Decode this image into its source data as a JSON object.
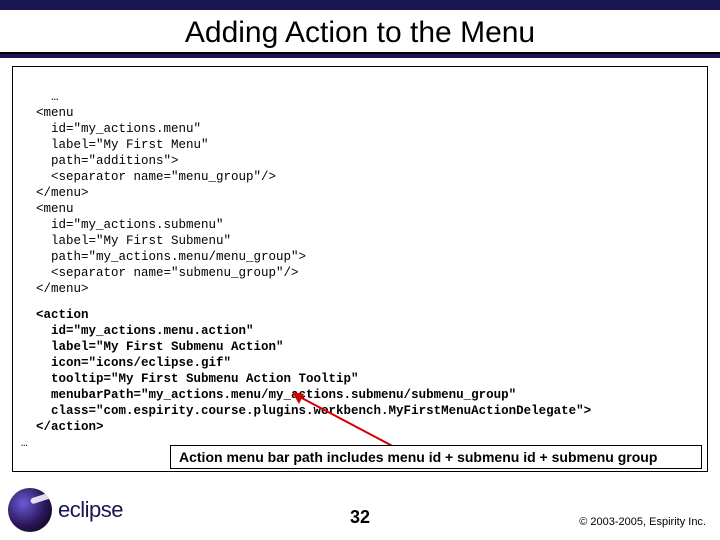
{
  "title": "Adding Action to the Menu",
  "code_block1": "…\n  <menu\n    id=\"my_actions.menu\"\n    label=\"My First Menu\"\n    path=\"additions\">\n    <separator name=\"menu_group\"/>\n  </menu>\n  <menu\n    id=\"my_actions.submenu\"\n    label=\"My First Submenu\"\n    path=\"my_actions.menu/menu_group\">\n    <separator name=\"submenu_group\"/>\n  </menu>",
  "code_block2": "  <action\n    id=\"my_actions.menu.action\"\n    label=\"My First Submenu Action\"\n    icon=\"icons/eclipse.gif\"\n    tooltip=\"My First Submenu Action Tooltip\"\n    menubarPath=\"my_actions.menu/my_actions.submenu/submenu_group\"\n    class=\"com.espirity.course.plugins.workbench.MyFirstMenuActionDelegate\">\n  </action>",
  "code_end": "…",
  "caption": "Action menu bar path includes menu id + submenu id + submenu group",
  "logo_text": "eclipse",
  "page_number": "32",
  "copyright": "© 2003-2005, Espirity Inc."
}
